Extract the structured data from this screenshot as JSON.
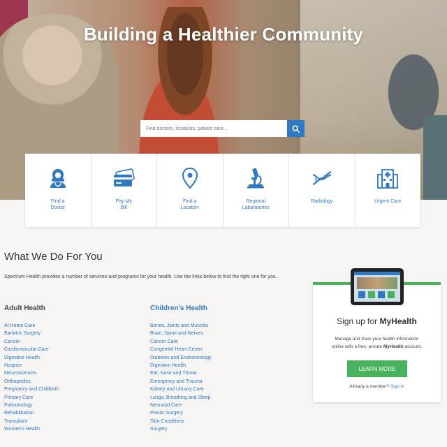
{
  "hero": {
    "title": "Building a Healthier Community",
    "search_placeholder": "Find doctors, locations, patient care...",
    "search_icon": "search-icon"
  },
  "quick_links": [
    {
      "label": "Find a\nDoctor",
      "icon": "doctor-icon"
    },
    {
      "label": "Pay My\nBill",
      "icon": "credit-card-icon"
    },
    {
      "label": "Find a\nLocation",
      "icon": "location-pin-icon"
    },
    {
      "label": "Regional\nLaboratories",
      "icon": "microscope-icon"
    },
    {
      "label": "Radiology",
      "icon": "dna-icon"
    },
    {
      "label": "Urgent Care",
      "icon": "hospital-icon"
    }
  ],
  "main": {
    "title": "What We Do For You",
    "intro": "Spectrum Health provides a number of services and programs for your health. Use the links below to find the right one for you."
  },
  "adult_health": {
    "heading": "Adult Health",
    "items": [
      "At Home Care",
      "Bariatric Surgery",
      "Cancer",
      "Cardiovascular Care",
      "Digestive Health",
      "Hospice",
      "Neurosciences",
      "Orthopedics",
      "Pregnancy and Childbirth",
      "Primary Care",
      "Pulmonology",
      "Rehabilitation",
      "Transplant",
      "Women's Health"
    ]
  },
  "childrens_health": {
    "heading": "Children's Health",
    "items": [
      "Bones, Joints and Muscles",
      "Brain, Spine and Nerves",
      "Cancer Care",
      "Congenital Heart Center",
      "Diabetes and Endocrinology",
      "Digestive Health",
      "Ear, Nose and Throat",
      "Emergency and Trauma",
      "Kidney and Urinary Care",
      "Lungs, Breathing and Sleep",
      "Neonatal Care",
      "Plastic Surgery",
      "Skin Conditions",
      "Surgery"
    ]
  },
  "myhealth": {
    "title_prefix": "Sign up for ",
    "title_brand": "MyHealth",
    "description_line1": "Manage and track your health information",
    "description_line2_prefix": "online with a free, private ",
    "description_brand": "MyHealth",
    "description_line2_suffix": " account.",
    "button_label": "LEARN MORE",
    "member_text": "Already a member?",
    "sign_in_label": "Sign in"
  },
  "colors": {
    "link_blue": "#2f78c4",
    "accent_green": "#49b25d",
    "background": "#f6f5f3"
  }
}
